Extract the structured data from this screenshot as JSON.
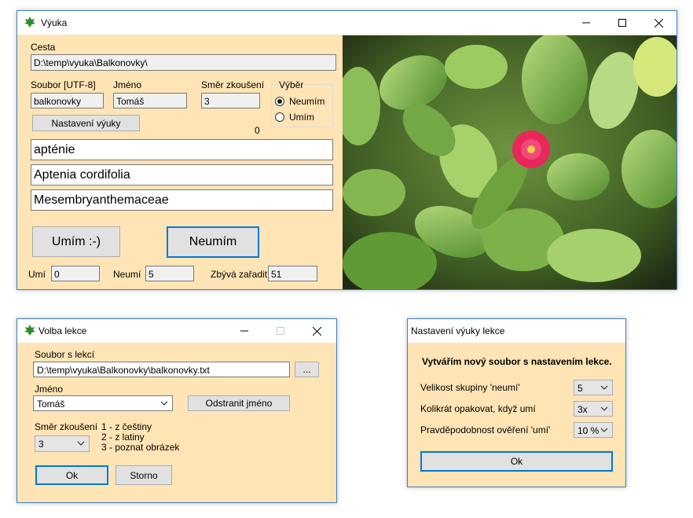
{
  "main": {
    "title": "Výuka",
    "path_label": "Cesta",
    "path_value": "D:\\temp\\vyuka\\Balkonovky\\",
    "file_label": "Soubor [UTF-8]",
    "file_value": "balkonovky",
    "name_label": "Jméno",
    "name_value": "Tomáš",
    "direction_label": "Směr zkoušení",
    "direction_value": "3",
    "choice_label": "Výběr",
    "choice_options": [
      "Neumím",
      "Umím"
    ],
    "choice_selected": "Neumím",
    "settings_button": "Nastavení výuky",
    "counter": "0",
    "answer1": "apténie",
    "answer2": "Aptenia cordifolia",
    "answer3": "Mesembryanthemaceae",
    "know_button": "Umím :-)",
    "dontknow_button": "Neumím",
    "known_label": "Umí",
    "known_value": "0",
    "unknown_label": "Neumí",
    "unknown_value": "5",
    "remaining_label": "Zbývá zařadit",
    "remaining_value": "51"
  },
  "lesson": {
    "title": "Volba lekce",
    "file_label": "Soubor s lekcí",
    "file_value": "D:\\temp\\vyuka\\Balkonovky\\balkonovky.txt",
    "browse_button": "...",
    "name_label": "Jméno",
    "name_value": "Tomáš",
    "remove_name_button": "Odstranit jméno",
    "direction_label": "Směr zkoušení",
    "direction_value": "3",
    "direction_help": [
      "1 - z češtiny",
      "2 - z latiny",
      "3 - poznat obrázek"
    ],
    "ok_button": "Ok",
    "cancel_button": "Storno"
  },
  "settings": {
    "title": "Nastavení výuky lekce",
    "heading": "Vytvářím nový soubor s nastavením lekce.",
    "group_size_label": "Velikost skupiny 'neumí'",
    "group_size_value": "5",
    "repeat_label": "Kolikrát opakovat, když umí",
    "repeat_value": "3x",
    "probability_label": "Pravděpodobnost ověření 'umí'",
    "probability_value": "10 %",
    "ok_button": "Ok"
  },
  "colors": {
    "accent": "#0078d7",
    "window_bg": "#ffe4b5",
    "flower": "#e8285c"
  }
}
